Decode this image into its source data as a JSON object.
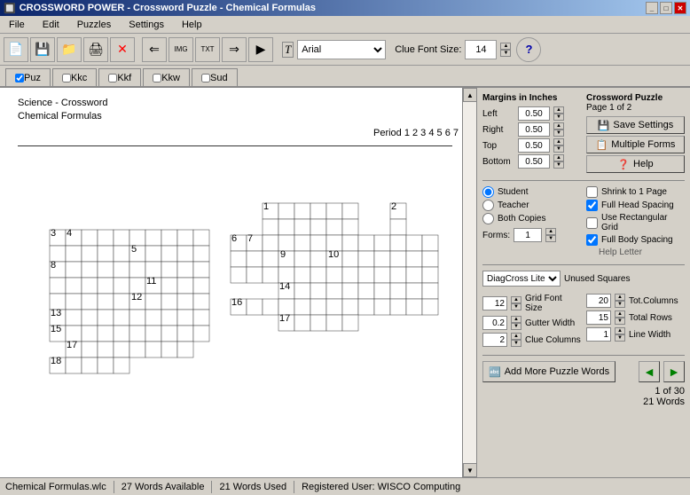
{
  "titleBar": {
    "icon": "⊞",
    "title": "CROSSWORD POWER - Crossword Puzzle - Chemical Formulas",
    "minimize": "_",
    "maximize": "□",
    "close": "✕"
  },
  "menuBar": {
    "items": [
      "File",
      "Edit",
      "Puzzles",
      "Settings",
      "Help"
    ]
  },
  "toolbar": {
    "fontLabel": "T",
    "fontValue": "Arial",
    "clueFontLabel": "Clue Font Size:",
    "clueFontValue": "14"
  },
  "tabs": {
    "items": [
      "Puz",
      "Kkc",
      "Kkf",
      "Kkw",
      "Sud"
    ]
  },
  "puzzle": {
    "title1": "Science - Crossword",
    "title2": "Chemical Formulas",
    "period": "Period  1  2  3  4  5  6  7"
  },
  "margins": {
    "title": "Margins in Inches",
    "left": {
      "label": "Left",
      "value": "0.50"
    },
    "right": {
      "label": "Right",
      "value": "0.50"
    },
    "top": {
      "label": "Top",
      "value": "0.50"
    },
    "bottom": {
      "label": "Bottom",
      "value": "0.50"
    }
  },
  "crosswordPuzzle": {
    "title": "Crossword Puzzle",
    "subtitle": "Page 1 of 2",
    "saveSettings": "Save Settings",
    "multipleForms": "Multiple Forms",
    "help": "Help"
  },
  "radioOptions": {
    "student": "Student",
    "teacher": "Teacher",
    "bothCopies": "Both Copies",
    "formsLabel": "Forms:",
    "formsValue": "1"
  },
  "checkboxOptions": {
    "shrinkToPage": {
      "label": "Shrink to 1 Page",
      "checked": false
    },
    "fullHeadSpacing": {
      "label": "Full Head Spacing",
      "checked": true
    },
    "useRectangularGrid": {
      "label": "Use Rectangular Grid",
      "checked": false
    },
    "fullBodySpacing": {
      "label": "Full Body Spacing",
      "checked": true
    },
    "helpLetter": "Help Letter"
  },
  "diagcross": {
    "value": "DiagCross Lite",
    "unusedLabel": "Unused Squares"
  },
  "settings": {
    "gridFontSize": {
      "label": "Grid Font Size",
      "value": "12",
      "value2": "20",
      "label2": "Tot.Columns"
    },
    "gutterWidth": {
      "label": "Gutter Width",
      "value": "0.2",
      "value2": "15",
      "label2": "Total Rows"
    },
    "clueColumns": {
      "label": "Clue Columns",
      "value": "2",
      "value2": "1",
      "label2": "Line Width"
    }
  },
  "bottomButtons": {
    "addWords": "Add More Puzzle Words",
    "prevArrow": "◄",
    "nextArrow": "►"
  },
  "countDisplay": {
    "line1": "1 of 30",
    "line2": "21 Words"
  },
  "statusBar": {
    "file": "Chemical Formulas.wlc",
    "wordsAvailable": "27 Words Available",
    "wordsUsed": "21 Words Used",
    "registeredUser": "Registered User: WISCO Computing"
  }
}
